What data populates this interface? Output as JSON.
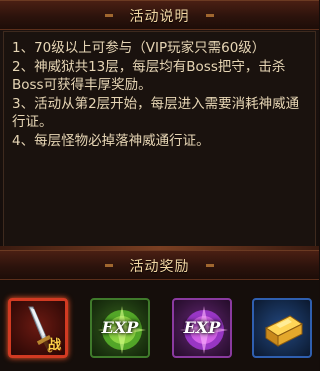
{
  "header_description": {
    "title": "活动说明"
  },
  "description": {
    "lines": [
      "1、70级以上可参与（VIP玩家只需60级）",
      "2、神威狱共13层，每层均有Boss把守，击杀Boss可获得丰厚奖励。",
      "3、活动从第2层开始，每层进入需要消耗神威通行证。",
      "4、每层怪物必掉落神威通行证。"
    ]
  },
  "header_rewards": {
    "title": "活动奖励"
  },
  "rewards": [
    {
      "icon": "sword-icon",
      "label": "战",
      "frame_color": "#d23a22"
    },
    {
      "icon": "exp-orb-green-icon",
      "label": "EXP",
      "frame_color": "#3f7a2b"
    },
    {
      "icon": "exp-orb-purple-icon",
      "label": "EXP",
      "frame_color": "#8a3aa0"
    },
    {
      "icon": "gold-bar-icon",
      "label": "",
      "frame_color": "#2f5fb0"
    }
  ]
}
